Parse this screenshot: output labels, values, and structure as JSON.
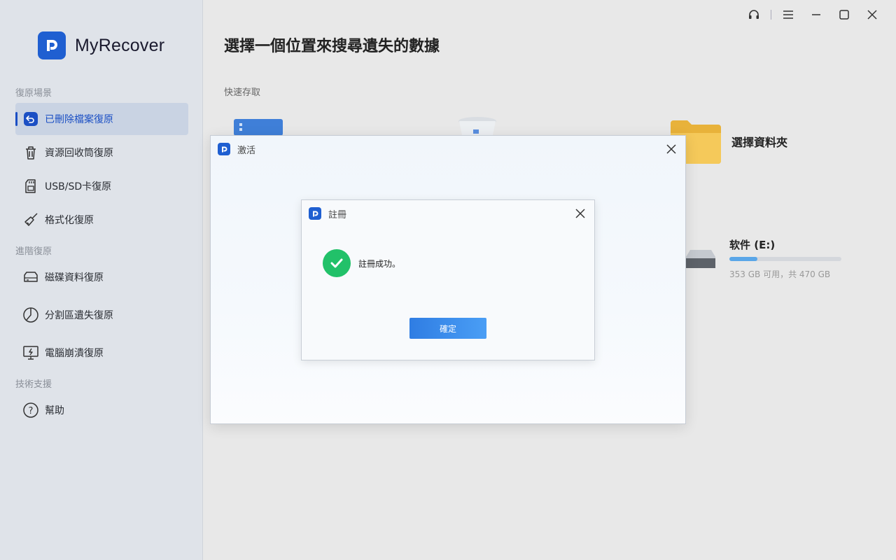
{
  "app": {
    "name": "MyRecover"
  },
  "sidebar": {
    "sections": [
      {
        "label": "復原場景"
      },
      {
        "label": "進階復原"
      },
      {
        "label": "技術支援"
      }
    ],
    "items": [
      {
        "label": "已刪除檔案復原",
        "icon": "undo-icon",
        "active": true
      },
      {
        "label": "資源回收筒復原",
        "icon": "trash-icon"
      },
      {
        "label": "USB/SD卡復原",
        "icon": "sd-card-icon"
      },
      {
        "label": "格式化復原",
        "icon": "broom-icon"
      },
      {
        "label": "磁碟資料復原",
        "icon": "hard-disk-icon"
      },
      {
        "label": "分割區遺失復原",
        "icon": "partition-icon"
      },
      {
        "label": "電腦崩潰復原",
        "icon": "monitor-crash-icon"
      },
      {
        "label": "幫助",
        "icon": "help-icon"
      }
    ]
  },
  "titlebar": {
    "icons": [
      "headset-icon",
      "menu-icon",
      "minimize-icon",
      "maximize-icon",
      "close-icon"
    ]
  },
  "main": {
    "title": "選擇一個位置來搜尋遺失的數據",
    "quick_access_label": "快速存取",
    "folder_label": "選擇資料夾",
    "drive": {
      "name": "软件 (E:)",
      "info": "353 GB 可用，共 470 GB",
      "used_fraction": 0.25
    }
  },
  "activate_dialog": {
    "title": "激活"
  },
  "register_dialog": {
    "title": "註冊",
    "message": "註冊成功。",
    "ok_label": "確定"
  },
  "colors": {
    "accent": "#1f5fd1",
    "success": "#22c169"
  }
}
